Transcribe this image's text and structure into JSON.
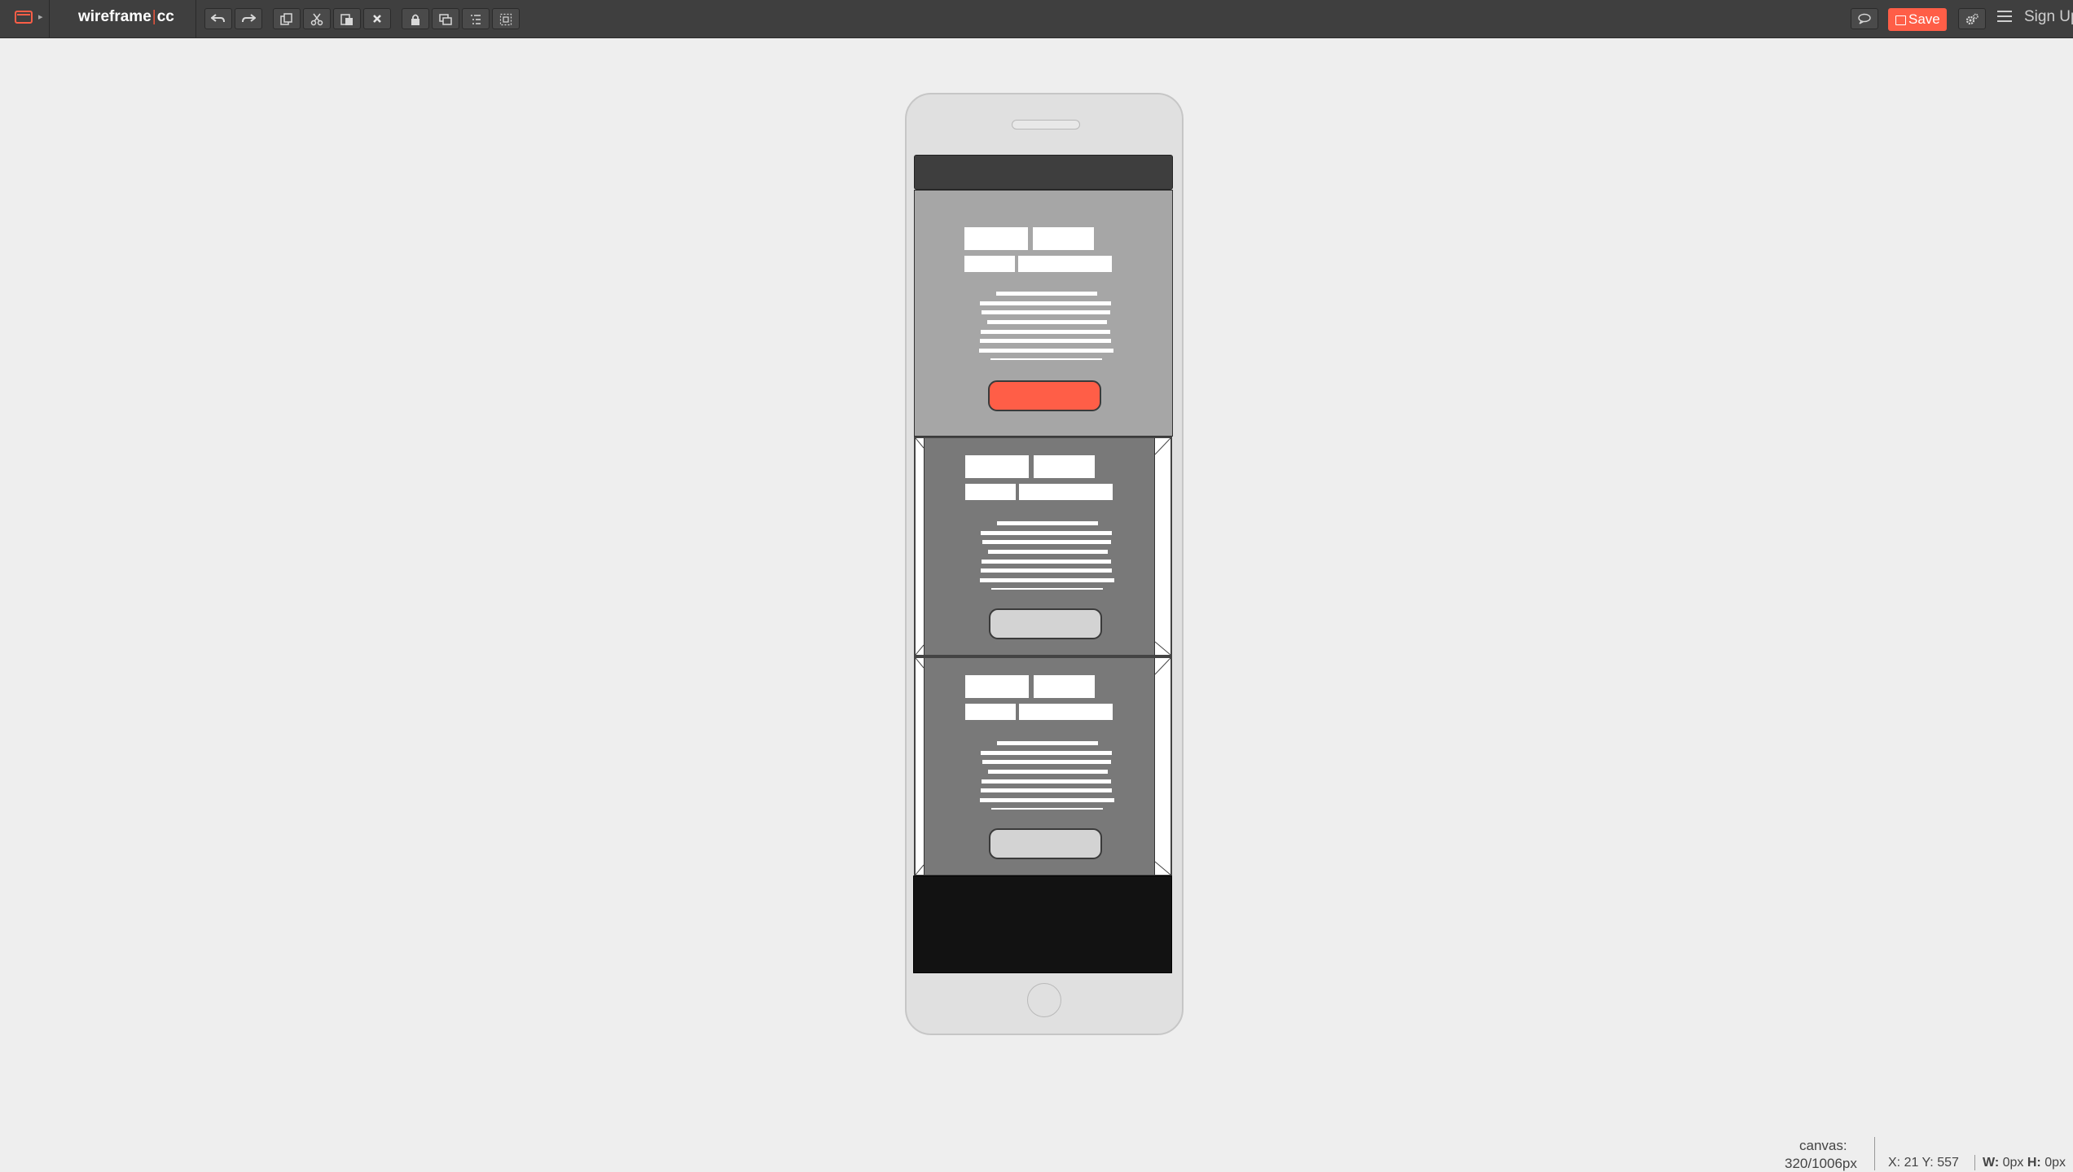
{
  "app": {
    "brand_left": "wireframe",
    "brand_sep": "|",
    "brand_right": "cc",
    "accent_color": "#ff5e47"
  },
  "toolbar": {
    "buttons": [
      {
        "name": "undo-button",
        "icon": "undo-icon"
      },
      {
        "name": "redo-button",
        "icon": "redo-icon"
      },
      {
        "name": "copy-button",
        "icon": "copy-icon"
      },
      {
        "name": "cut-button",
        "icon": "scissors-icon"
      },
      {
        "name": "paste-button",
        "icon": "paste-icon"
      },
      {
        "name": "delete-button",
        "icon": "close-icon"
      },
      {
        "name": "lock-button",
        "icon": "lock-icon"
      },
      {
        "name": "arrange-button",
        "icon": "layers-icon"
      },
      {
        "name": "list-button",
        "icon": "list-icon"
      },
      {
        "name": "select-button",
        "icon": "select-icon"
      }
    ],
    "comment_icon": "speech-bubble-icon",
    "save_label": "Save",
    "settings_icon": "gears-icon",
    "menu_icon": "hamburger-icon",
    "signup_label": "Sign Up"
  },
  "canvas": {
    "device": "phone",
    "hero_button_color": "#ff5e47",
    "panel_button_color": "#d3d3d3"
  },
  "status": {
    "canvas_label": "canvas:",
    "canvas_size": "320/1006px",
    "coords": "X: 21 Y: 557",
    "w_label": "W:",
    "w_value": "0px",
    "h_label": "H:",
    "h_value": "0px"
  }
}
